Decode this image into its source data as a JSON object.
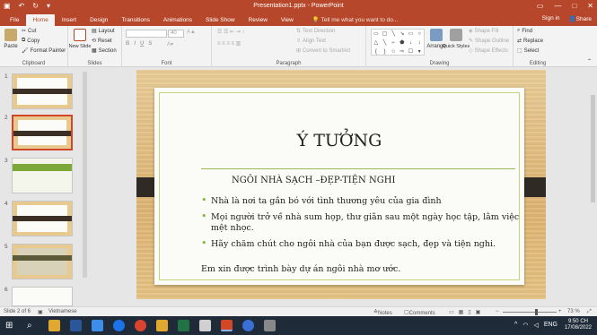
{
  "window": {
    "title": "Presentation1.pptx - PowerPoint"
  },
  "tabs": [
    "File",
    "Home",
    "Insert",
    "Design",
    "Transitions",
    "Animations",
    "Slide Show",
    "Review",
    "View"
  ],
  "tellme": "Tell me what you want to do...",
  "account": {
    "signin": "Sign in",
    "share": "Share"
  },
  "ribbon": {
    "clipboard": {
      "paste": "Paste",
      "cut": "Cut",
      "copy": "Copy",
      "format_painter": "Format Painter",
      "label": "Clipboard"
    },
    "slides": {
      "new_slide": "New Slide",
      "layout": "Layout",
      "reset": "Reset",
      "section": "Section",
      "label": "Slides"
    },
    "font": {
      "size": "40",
      "label": "Font"
    },
    "paragraph": {
      "text_direction": "Text Direction",
      "align_text": "Align Text",
      "smartart": "Convert to SmartArt",
      "label": "Paragraph"
    },
    "drawing": {
      "arrange": "Arrange",
      "quick_styles": "Quick Styles",
      "shape_fill": "Shape Fill",
      "shape_outline": "Shape Outline",
      "shape_effects": "Shape Effects",
      "label": "Drawing"
    },
    "editing": {
      "find": "Find",
      "replace": "Replace",
      "select": "Select",
      "label": "Editing"
    }
  },
  "thumbnails": [
    "1",
    "2",
    "3",
    "4",
    "5",
    "6"
  ],
  "slide": {
    "title": "Ý TƯỞNG",
    "heading": "NGÔI NHÀ SẠCH –ĐẸP-TIỆN NGHI",
    "bullets": [
      "Nhà là nơi ta gắn bó với tình thương yêu của gia đình",
      "Mọi người trở về nhà sum họp, thư giãn sau một ngày học tập, lằm việc mệt nhọc.",
      "Hãy chăm chút cho ngôi nhà của bạn được sạch, đẹp và tiện nghi."
    ],
    "closing": "Em xin được trình bày dự án ngôi nhà mơ ước."
  },
  "status": {
    "slide": "Slide 2 of 6",
    "language": "Vietnamese",
    "notes": "Notes",
    "comments": "Comments",
    "zoom": "73 %"
  },
  "taskbar": {
    "time": "9:50 CH",
    "date": "17/08/2022",
    "lang": "ENG"
  }
}
